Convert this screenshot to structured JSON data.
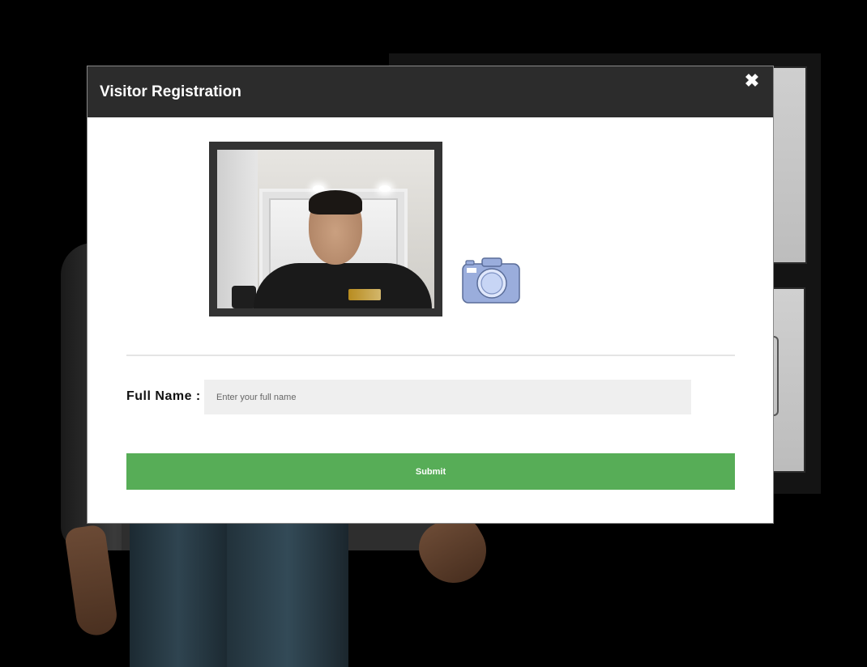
{
  "modal": {
    "title": "Visitor Registration",
    "close_icon": "close-icon"
  },
  "camera": {
    "capture_icon": "camera-icon",
    "accent_color": "#9aaddc"
  },
  "form": {
    "full_name_label": "Full Name :",
    "full_name_value": "",
    "full_name_placeholder": "Enter your full name",
    "submit_label": "Submit",
    "submit_color": "#57ad57"
  },
  "colors": {
    "header_bg": "#2c2c2c",
    "page_bg": "#000000"
  }
}
